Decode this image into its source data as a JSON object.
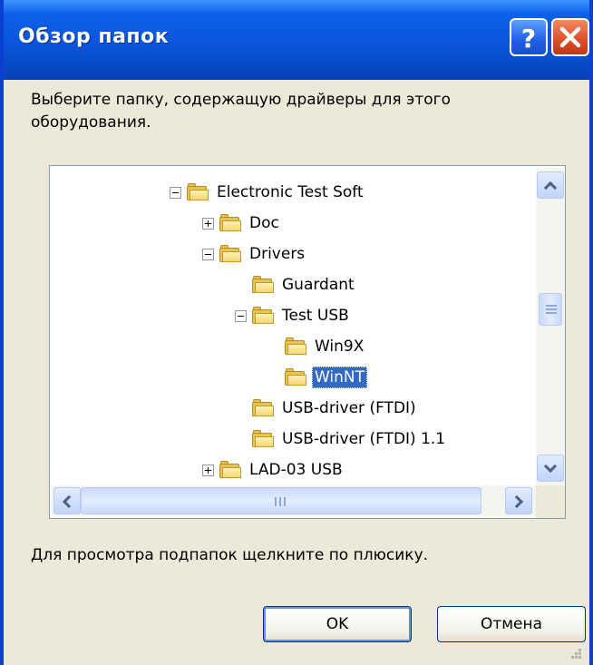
{
  "window": {
    "title": "Обзор папок",
    "help_icon": "question-mark-icon",
    "close_icon": "close-x-icon"
  },
  "instruction": "Выберите папку, содержащую драйверы для этого оборудования.",
  "tree": {
    "items": [
      {
        "label": "Electronic Test Soft",
        "expander": "minus",
        "icon": "folder-icon"
      },
      {
        "label": "Doc",
        "expander": "plus",
        "icon": "folder-icon"
      },
      {
        "label": "Drivers",
        "expander": "minus",
        "icon": "folder-icon"
      },
      {
        "label": "Guardant",
        "expander": "none",
        "icon": "folder-icon"
      },
      {
        "label": "Test USB",
        "expander": "minus",
        "icon": "folder-icon"
      },
      {
        "label": "Win9X",
        "expander": "none",
        "icon": "folder-icon"
      },
      {
        "label": "WinNT",
        "expander": "none",
        "icon": "open-folder-icon",
        "selected": true
      },
      {
        "label": "USB-driver (FTDI)",
        "expander": "none",
        "icon": "folder-icon"
      },
      {
        "label": "USB-driver (FTDI) 1.1",
        "expander": "none",
        "icon": "folder-icon"
      },
      {
        "label": "LAD-03 USB",
        "expander": "plus",
        "icon": "folder-icon"
      }
    ]
  },
  "hint": "Для просмотра подпапок щелкните по плюсику.",
  "buttons": {
    "ok_label": "OK",
    "cancel_label": "Отмена"
  },
  "colors": {
    "titlebar": "#0A55DB",
    "selection": "#316AC5",
    "dialog_bg": "#ECE9D8"
  }
}
